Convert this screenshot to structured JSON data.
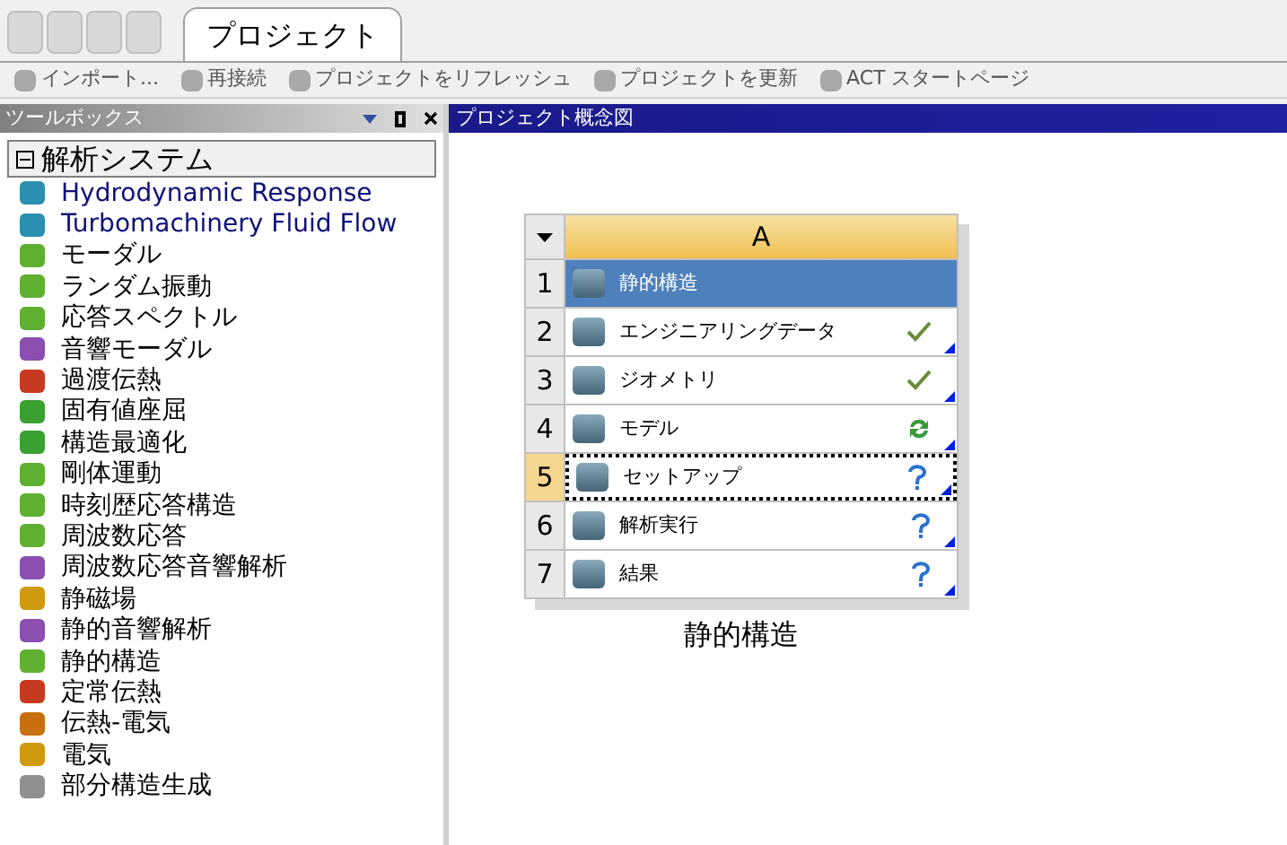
{
  "tabs": [
    {
      "label": "プロジェクト",
      "selected": true
    }
  ],
  "toolbar": [
    {
      "label": "インポート..."
    },
    {
      "label": "再接続"
    },
    {
      "label": "プロジェクトをリフレッシュ"
    },
    {
      "label": "プロジェクトを更新"
    },
    {
      "label": "ACT スタートページ"
    }
  ],
  "toolbox": {
    "title": "ツールボックス",
    "group": {
      "label": "解析システム",
      "expanded": true
    },
    "items": [
      {
        "label": "Hydrodynamic Response",
        "color": "#2a8fb0",
        "english": true
      },
      {
        "label": "Turbomachinery Fluid Flow",
        "color": "#2a8fb0",
        "english": true
      },
      {
        "label": "モーダル",
        "color": "#5fb030"
      },
      {
        "label": "ランダム振動",
        "color": "#5fb030"
      },
      {
        "label": "応答スペクトル",
        "color": "#5fb030"
      },
      {
        "label": "音響モーダル",
        "color": "#8a4fb0"
      },
      {
        "label": "過渡伝熱",
        "color": "#c83a20"
      },
      {
        "label": "固有値座屈",
        "color": "#3aa030"
      },
      {
        "label": "構造最適化",
        "color": "#3aa030"
      },
      {
        "label": "剛体運動",
        "color": "#5fb030"
      },
      {
        "label": "時刻歴応答構造",
        "color": "#5fb030"
      },
      {
        "label": "周波数応答",
        "color": "#5fb030"
      },
      {
        "label": "周波数応答音響解析",
        "color": "#8a4fb0"
      },
      {
        "label": "静磁場",
        "color": "#d09a10"
      },
      {
        "label": "静的音響解析",
        "color": "#8a4fb0"
      },
      {
        "label": "静的構造",
        "color": "#5fb030"
      },
      {
        "label": "定常伝熱",
        "color": "#c83a20"
      },
      {
        "label": "伝熱-電気",
        "color": "#c87010"
      },
      {
        "label": "電気",
        "color": "#d09a10"
      },
      {
        "label": "部分構造生成",
        "color": "#909090"
      }
    ]
  },
  "schematic": {
    "title": "プロジェクト概念図",
    "system": {
      "column": "A",
      "name": "静的構造",
      "rows": [
        {
          "number": "1",
          "label": "静的構造",
          "kind": "none",
          "selected": true,
          "focused": false
        },
        {
          "number": "2",
          "label": "エンジニアリングデータ",
          "kind": "check",
          "selected": false,
          "focused": false
        },
        {
          "number": "3",
          "label": "ジオメトリ",
          "kind": "check",
          "selected": false,
          "focused": false
        },
        {
          "number": "4",
          "label": "モデル",
          "kind": "refresh",
          "selected": false,
          "focused": false
        },
        {
          "number": "5",
          "label": "セットアップ",
          "kind": "question",
          "selected": false,
          "focused": true
        },
        {
          "number": "6",
          "label": "解析実行",
          "kind": "question",
          "selected": false,
          "focused": false
        },
        {
          "number": "7",
          "label": "結果",
          "kind": "question",
          "selected": false,
          "focused": false
        }
      ]
    }
  }
}
